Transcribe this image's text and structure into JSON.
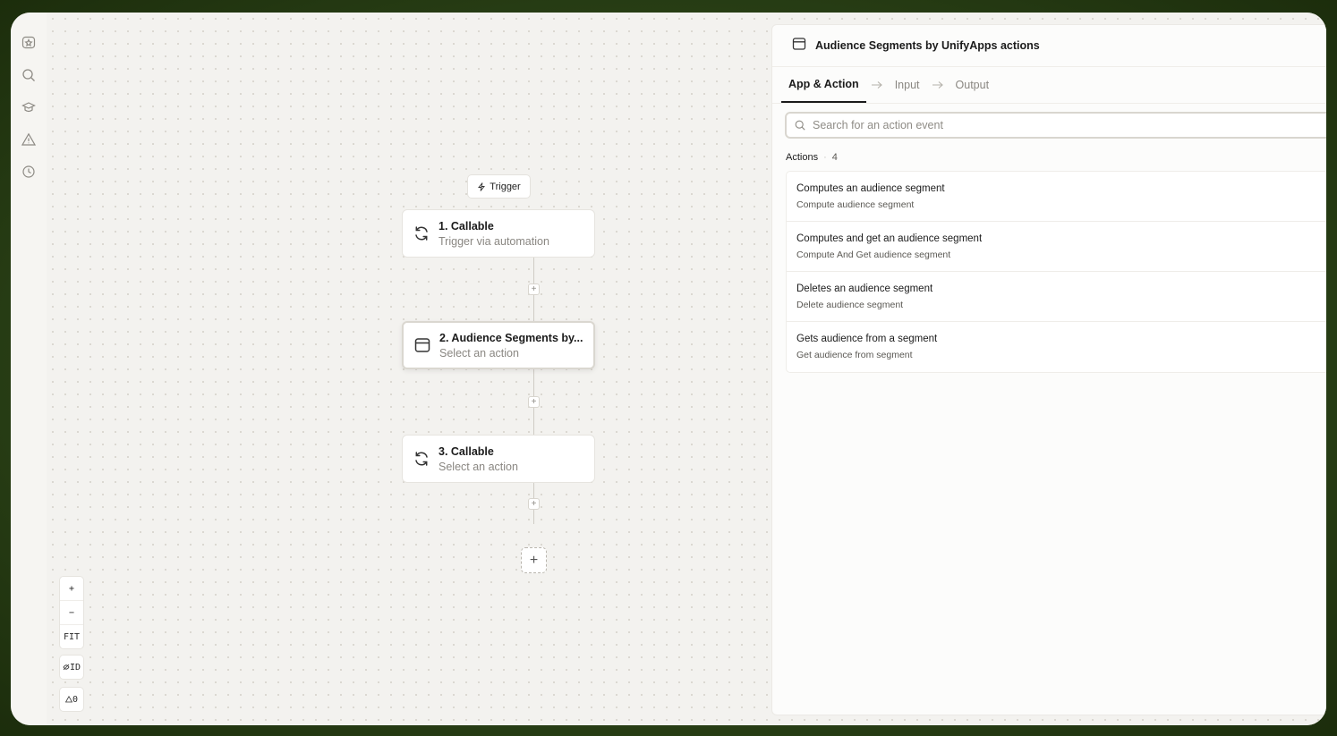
{
  "canvas": {
    "trigger_label": "Trigger",
    "nodes": [
      {
        "title": "1. Callable",
        "subtitle": "Trigger via automation"
      },
      {
        "title": "2. Audience Segments by...",
        "subtitle": "Select an action"
      },
      {
        "title": "3. Callable",
        "subtitle": "Select an action"
      }
    ],
    "add_step_symbol": "+",
    "zoom_controls": {
      "zoom_in": "+",
      "zoom_out": "−",
      "fit": "FIT",
      "id_toggle": "ID",
      "warnings": "0"
    }
  },
  "panel": {
    "title": "Audience Segments by UnifyApps actions",
    "tabs": [
      {
        "label": "App & Action",
        "active": true
      },
      {
        "label": "Input",
        "active": false
      },
      {
        "label": "Output",
        "active": false
      }
    ],
    "search": {
      "placeholder": "Search for an action event",
      "value": ""
    },
    "actions_label": "Actions",
    "actions_count": "4",
    "actions": [
      {
        "title": "Computes an audience segment",
        "description": "Compute audience segment"
      },
      {
        "title": "Computes and get an audience segment",
        "description": "Compute And Get audience segment"
      },
      {
        "title": "Deletes an audience segment",
        "description": "Delete audience segment"
      },
      {
        "title": "Gets audience from a segment",
        "description": "Get audience from segment"
      }
    ]
  },
  "sidebar": {
    "icons": [
      "logo-icon",
      "search-icon",
      "learn-icon",
      "warning-icon",
      "history-icon"
    ]
  },
  "colors": {
    "background_outer": "#2c4418",
    "canvas": "#f3f2ef",
    "panel": "#fcfcfb",
    "text_primary": "#1b1b1b",
    "text_muted": "#8a8782"
  }
}
